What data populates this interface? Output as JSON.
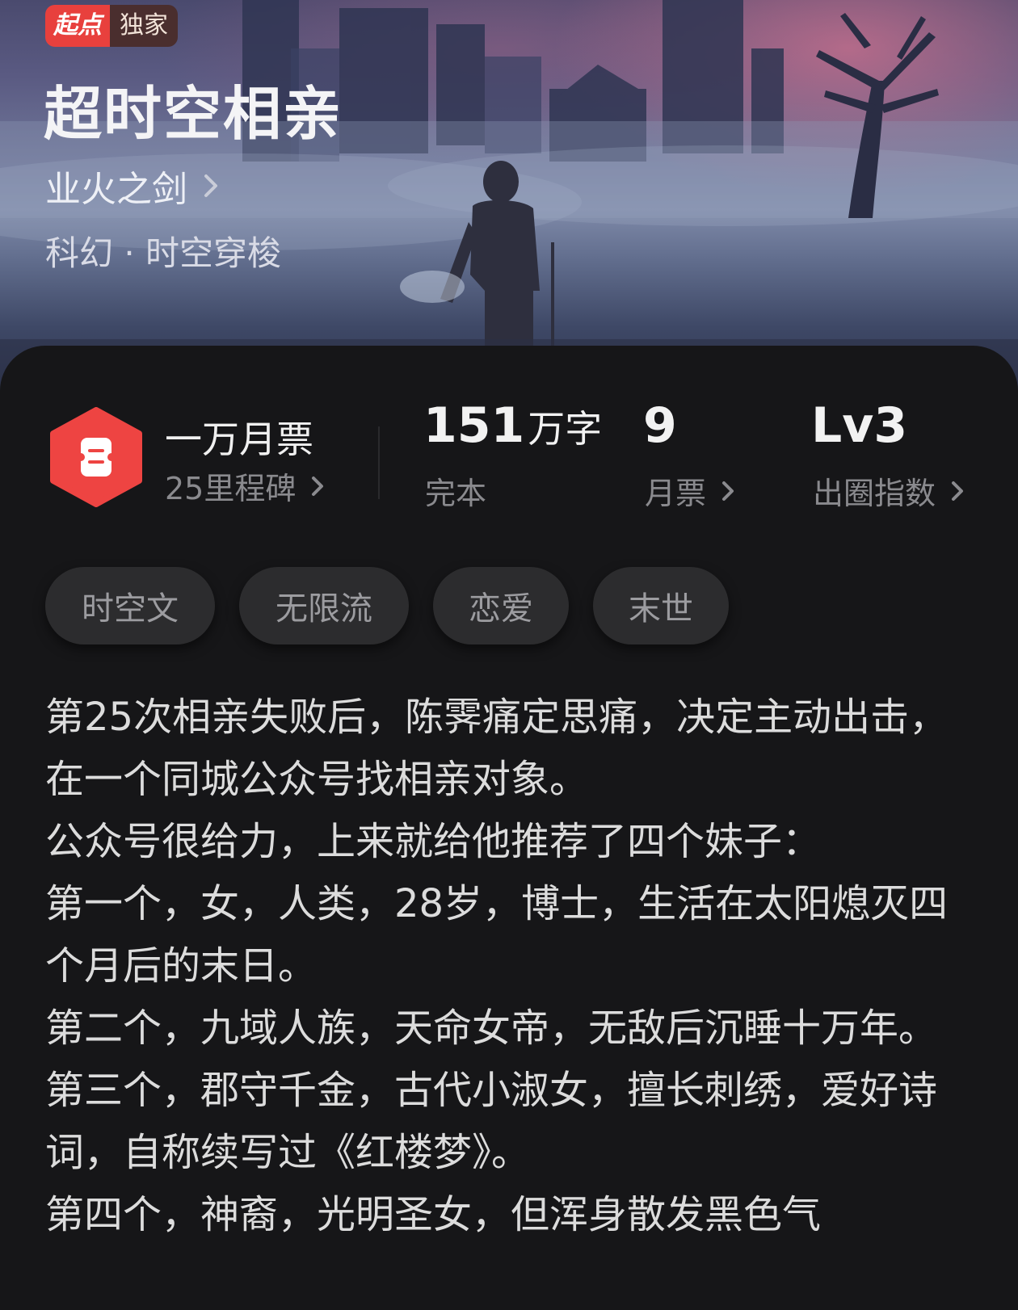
{
  "badge": {
    "brand": "起点",
    "label": "独家"
  },
  "book": {
    "title": "超时空相亲",
    "author": "业火之剑",
    "genre": "科幻 · 时空穿梭"
  },
  "stats": {
    "award_title": "一万月票",
    "award_sub": "25里程碑",
    "word_count_value": "151",
    "word_count_unit": "万字",
    "status": "完本",
    "monthly_votes_value": "9",
    "monthly_votes_label": "月票",
    "influence_value": "Lv3",
    "influence_label": "出圈指数"
  },
  "tags": [
    "时空文",
    "无限流",
    "恋爱",
    "末世"
  ],
  "synopsis": [
    "第25次相亲失败后，陈霁痛定思痛，决定主动出击，在一个同城公众号找相亲对象。",
    "公众号很给力，上来就给他推荐了四个妹子：",
    "第一个，女，人类，28岁，博士，生活在太阳熄灭四个月后的末日。",
    "第二个，九域人族，天命女帝，无敌后沉睡十万年。",
    "第三个，郡守千金，古代小淑女，擅长刺绣，爱好诗词，自称续写过《红楼梦》。",
    "第四个，神裔，光明圣女，但浑身散发黑色气"
  ],
  "colors": {
    "background": "#161618",
    "brand_red": "#e8403d",
    "tag_bg": "#2c2c2e",
    "muted_text": "#8a8a8e"
  }
}
